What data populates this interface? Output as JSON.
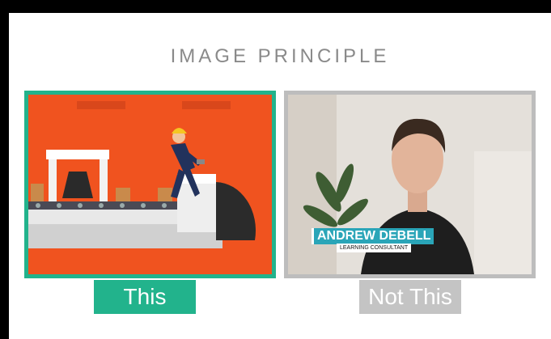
{
  "slide": {
    "title": "IMAGE PRINCIPLE",
    "good": {
      "label": "This"
    },
    "bad": {
      "label": "Not This",
      "lower_third": {
        "name": "ANDREW DEBELL",
        "role": "LEARNING CONSULTANT"
      }
    }
  },
  "colors": {
    "accent": "#22b38c",
    "muted": "#c4c4c4",
    "illustration_bg": "#f0531f",
    "lowerthird": "#2aa5b8"
  }
}
